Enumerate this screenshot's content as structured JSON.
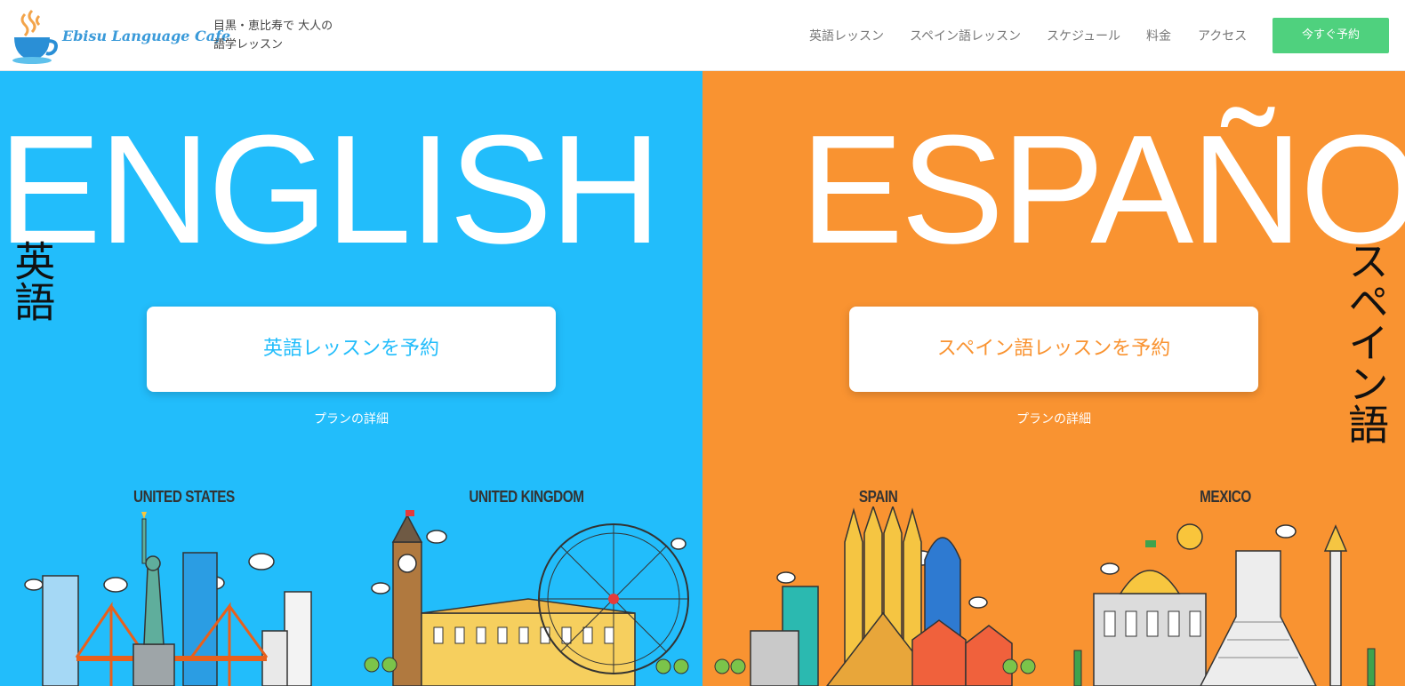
{
  "header": {
    "logo_text": "Ebisu Language Cafe",
    "tagline_line1": "目黒・恵比寿で 大人の",
    "tagline_line2": "語学レッスン",
    "nav": [
      "英語レッスン",
      "スペイン語レッスン",
      "スケジュール",
      "料金",
      "アクセス"
    ],
    "cta_label": "今すぐ予約"
  },
  "english": {
    "big_word": "ENGLISH",
    "vertical_label": "英語",
    "cta_label": "英語レッスンを予約",
    "plan_link": "プランの詳細",
    "countries": [
      "UNITED STATES",
      "UNITED KINGDOM"
    ]
  },
  "spanish": {
    "big_word": "ESPAÑOL",
    "vertical_label": "スペイン語",
    "cta_label": "スペイン語レッスンを予約",
    "plan_link": "プランの詳細",
    "countries": [
      "SPAIN",
      "MEXICO"
    ]
  },
  "colors": {
    "english_bg": "#22bdfb",
    "spanish_bg": "#f99331",
    "reserve_green": "#4fd17e"
  }
}
